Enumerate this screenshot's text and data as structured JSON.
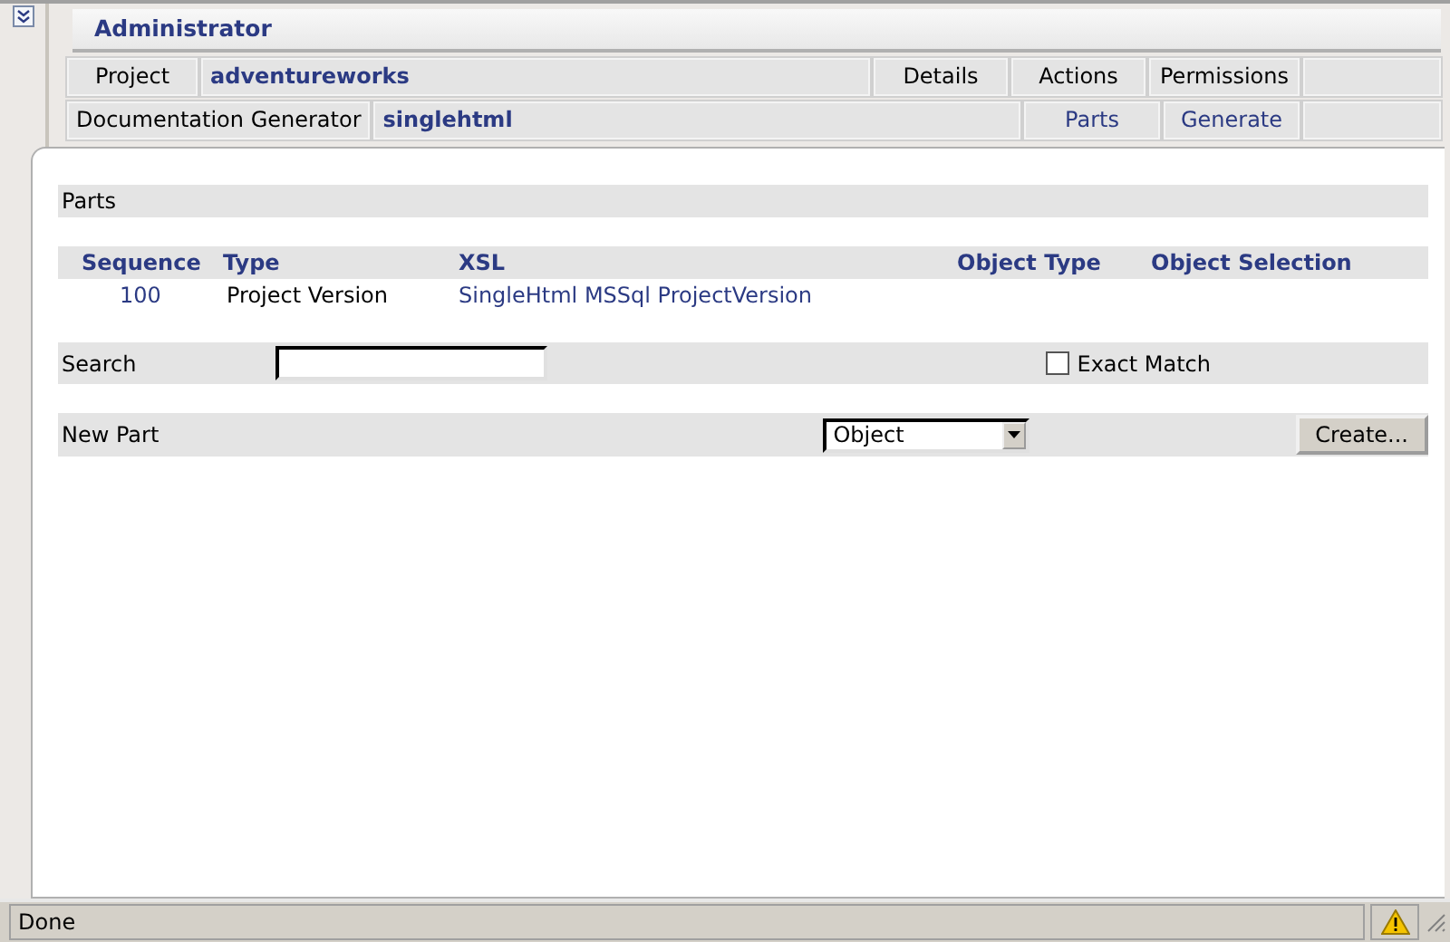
{
  "header": {
    "title": "Administrator"
  },
  "nav_rows": [
    {
      "label": "Project",
      "value": "adventureworks",
      "actions": [
        {
          "text": "Details",
          "kind": "tab"
        },
        {
          "text": "Actions",
          "kind": "tab"
        },
        {
          "text": "Permissions",
          "kind": "tab"
        }
      ]
    },
    {
      "label": "Documentation Generator",
      "value": "singlehtml",
      "actions": [
        {
          "text": "Parts",
          "kind": "link"
        },
        {
          "text": "Generate",
          "kind": "link"
        }
      ]
    }
  ],
  "parts_section": {
    "title": "Parts"
  },
  "table": {
    "columns": [
      "Sequence",
      "Type",
      "XSL",
      "Object Type",
      "Object Selection"
    ],
    "rows": [
      {
        "sequence": "100",
        "type": "Project Version",
        "xsl": "SingleHtml MSSql ProjectVersion"
      }
    ]
  },
  "search": {
    "label": "Search",
    "exact_match": {
      "label": "Exact Match",
      "checked": false
    }
  },
  "new_part": {
    "label": "New Part",
    "selected_option": "Object",
    "button": "Create..."
  },
  "status_bar": {
    "text": "Done"
  }
}
